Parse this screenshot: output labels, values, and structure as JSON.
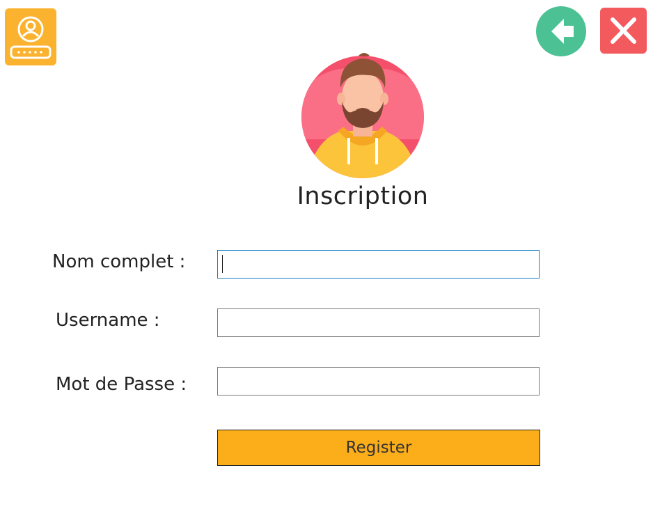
{
  "window": {
    "logo_icon": "user-login-icon",
    "back_icon": "arrow-left-icon",
    "close_icon": "close-icon"
  },
  "header": {
    "avatar_icon": "bearded-man-avatar",
    "title": "Inscription"
  },
  "form": {
    "fields": [
      {
        "label": "Nom complet :",
        "value": "",
        "focused": true
      },
      {
        "label": "Username :",
        "value": ""
      },
      {
        "label": "Mot de Passe :",
        "value": ""
      }
    ],
    "submit_label": "Register"
  },
  "colors": {
    "accent_orange": "#fbae19",
    "back_green": "#4bc194",
    "close_red": "#f25a5e",
    "avatar_bg": "#f5506b",
    "focus_border": "#1b7fc4"
  }
}
